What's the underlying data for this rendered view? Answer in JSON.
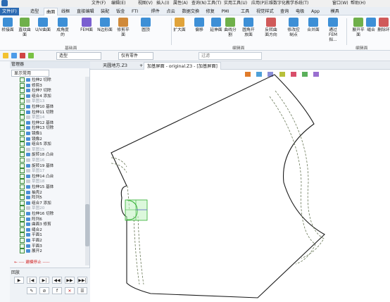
{
  "menu": [
    "文件(F)",
    "编辑(E)",
    "视图(V)",
    "插入(I)",
    "属性(A)",
    "查询(N)",
    "工具(T)",
    "实用工具(U)",
    "应用(P)",
    "三维数字化教学系统(T)",
    "窗口(W)",
    "帮助(H)"
  ],
  "file_tab": "文件(F)",
  "ribbon_tabs": [
    "造型",
    "曲面",
    "线框",
    "直接编辑",
    "装配",
    "钣金",
    "FTI",
    "焊件",
    "点云",
    "数据交换",
    "修复",
    "PMI",
    "工具",
    "视觉样式",
    "查询",
    "电极",
    "App",
    "模具"
  ],
  "active_tab": "曲面",
  "ribbon_buttons": [
    "桥接面",
    "直纹曲面",
    "U/V曲面",
    "成角度的",
    "FEM面",
    "N边形面",
    "修剪平面",
    "圆顶",
    "扩大面",
    "偏移",
    "延伸面",
    "曲线分割",
    "圆角开放面",
    "反转曲面方向",
    "修改控制点",
    "合并面",
    "通过FEM拟...",
    "展开平面",
    "缝合",
    "删除环"
  ],
  "group_labels": [
    "基础面",
    "编辑面",
    "编辑面"
  ],
  "toolbar": {
    "mode_combo": "造型",
    "filter_combo": "仅有零件",
    "search_placeholder": "过滤"
  },
  "panel": {
    "title": "管理器",
    "filter": "显示常用",
    "bottom_title": "回放"
  },
  "tree_items": [
    {
      "label": "拉伸2 切除",
      "off": false
    },
    {
      "label": "修剪3",
      "off": false
    },
    {
      "label": "拉伸7 切除",
      "off": false
    },
    {
      "label": "组合4 添加",
      "off": false
    },
    {
      "label": "草图13",
      "off": true
    },
    {
      "label": "拉伸10 基体",
      "off": false
    },
    {
      "label": "拉伸11 切除",
      "off": false
    },
    {
      "label": "草图14",
      "off": true
    },
    {
      "label": "拉伸12 基体",
      "off": false
    },
    {
      "label": "拉伸13 切除",
      "off": false
    },
    {
      "label": "镜像1",
      "off": false
    },
    {
      "label": "镜像2",
      "off": false
    },
    {
      "label": "组合5 添加",
      "off": false
    },
    {
      "label": "草图15",
      "off": true
    },
    {
      "label": "旋转18 凸台",
      "off": false
    },
    {
      "label": "草图16",
      "off": true
    },
    {
      "label": "旋转19 基体",
      "off": false
    },
    {
      "label": "草图17",
      "off": true
    },
    {
      "label": "拉伸14 凸台",
      "off": false
    },
    {
      "label": "草图18",
      "off": true
    },
    {
      "label": "拉伸15 基体",
      "off": false
    },
    {
      "label": "抽壳2",
      "off": false
    },
    {
      "label": "阵列5",
      "off": false
    },
    {
      "label": "组合7 添加",
      "off": false
    },
    {
      "label": "草图20",
      "off": true
    },
    {
      "label": "拉伸16 切除",
      "off": false
    },
    {
      "label": "阵列6",
      "off": false
    },
    {
      "label": "曲面3 修剪",
      "off": false
    },
    {
      "label": "缝合2",
      "off": false
    },
    {
      "label": "平面1",
      "off": false
    },
    {
      "label": "平面2",
      "off": false
    },
    {
      "label": "平面3",
      "off": false
    },
    {
      "label": "展开2",
      "off": false
    }
  ],
  "stop_marker": "---- 建模停止 -----",
  "doc_tabs": [
    "天圆地方.Z3",
    "加基屏面 - original.Z3 - [加基屏面]"
  ],
  "active_doc": 1,
  "colors": {
    "accent": "#2d6bb3",
    "outline": "#1a1a1a",
    "dashed": "#6b7a5a",
    "highlight_fill": "#bff2bf",
    "highlight_stroke": "#2fae2f",
    "stop_marker": "#d02020"
  }
}
